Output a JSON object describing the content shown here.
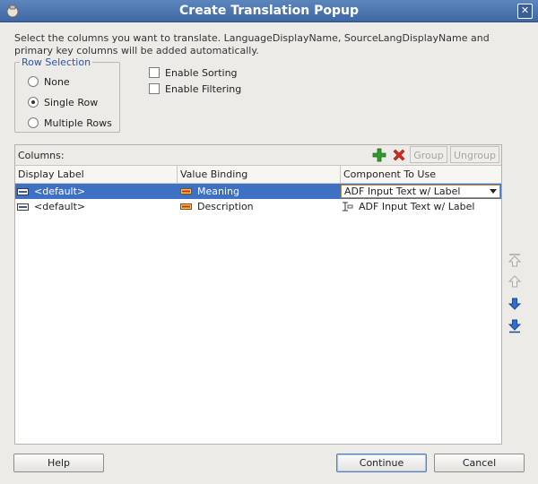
{
  "window": {
    "title": "Create Translation Popup",
    "close_glyph": "✕",
    "icon": "app-icon"
  },
  "description": "Select the columns you want to translate.  LanguageDisplayName, SourceLangDisplayName and primary key columns will be added automatically.",
  "row_selection": {
    "legend": "Row Selection",
    "options": [
      {
        "label": "None",
        "checked": false
      },
      {
        "label": "Single Row",
        "checked": true
      },
      {
        "label": "Multiple Rows",
        "checked": false
      }
    ]
  },
  "options": {
    "enable_sorting": {
      "label": "Enable Sorting",
      "checked": false
    },
    "enable_filtering": {
      "label": "Enable Filtering",
      "checked": false
    }
  },
  "columns_panel": {
    "label": "Columns:",
    "group_label": "Group",
    "ungroup_label": "Ungroup",
    "headers": [
      "Display Label",
      "Value Binding",
      "Component To Use"
    ],
    "rows": [
      {
        "display_label": "<default>",
        "value_binding": "Meaning",
        "component": "ADF Input Text w/ Label",
        "selected": true
      },
      {
        "display_label": "<default>",
        "value_binding": "Description",
        "component": "ADF Input Text w/ Label",
        "selected": false
      }
    ]
  },
  "buttons": {
    "help": "Help",
    "continue": "Continue",
    "cancel": "Cancel"
  },
  "colors": {
    "title_bar": "#4a74ad",
    "selection": "#3e70c4",
    "add_icon": "#2f9a2f",
    "remove_icon": "#d52b1e",
    "arrow_icon": "#2f6fce"
  }
}
